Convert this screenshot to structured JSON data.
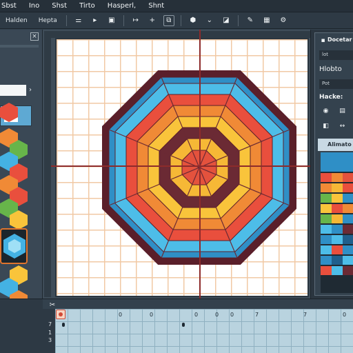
{
  "menu": {
    "items": [
      "Sbst",
      "Ino",
      "Shst",
      "Tirto",
      "Hasperl,",
      "Shnt"
    ]
  },
  "toolbar": {
    "label": "Halden",
    "label2": "Hepta"
  },
  "right_panel": {
    "title": "Docetar",
    "chip1": "lot",
    "label1": "Hlobto",
    "chip2": "Pot",
    "label2": "Hacke:",
    "tab": "Alimato"
  },
  "timeline": {
    "row_labels": [
      "7",
      "1",
      "3"
    ],
    "frame_labels": [
      "0",
      "0",
      "0",
      "0",
      "0",
      "7",
      "7",
      "0"
    ]
  },
  "colors": {
    "accent": "#e0742d",
    "guide": "#8d2b2b",
    "octagon_rings": [
      "#2f8fc6",
      "#4dbde8",
      "#e94f3d",
      "#f08a36",
      "#f9c43b",
      "#6b2a34",
      "#f6b836",
      "#e4523d"
    ]
  },
  "icons": {
    "panel_close": "close-icon",
    "layer_eye": "eye-icon",
    "layer_lock": "lock-icon"
  }
}
